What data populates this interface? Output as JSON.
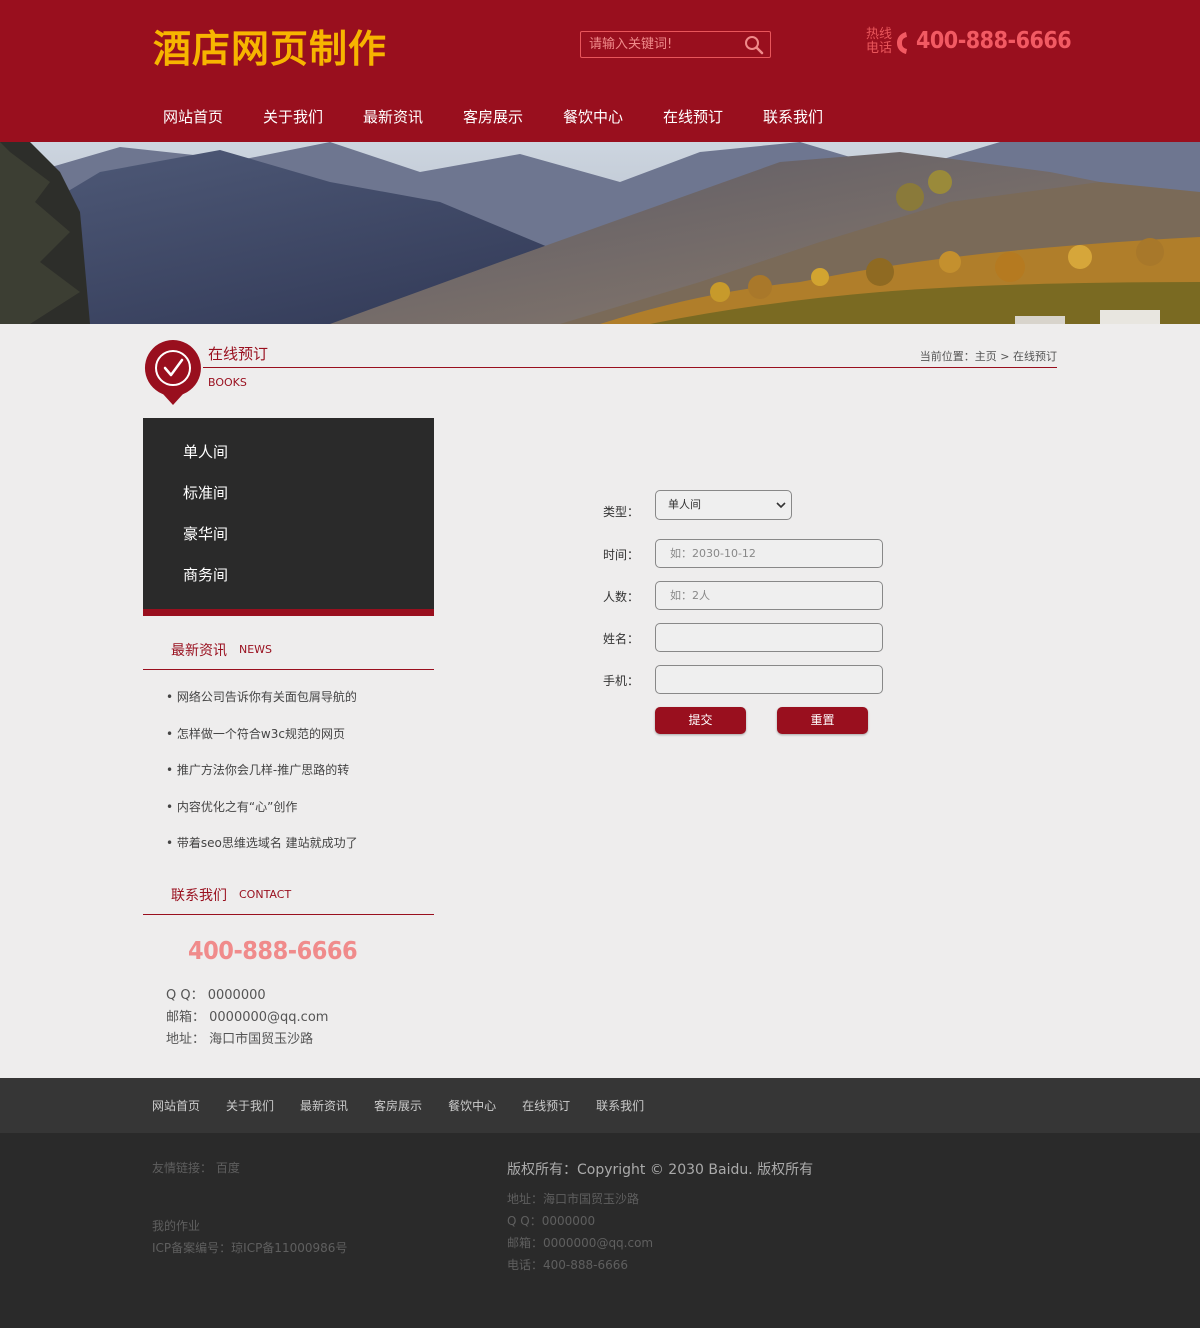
{
  "header": {
    "logo": "酒店网页制作",
    "search_placeholder": "请输入关键词!",
    "hotline_label_1": "热线",
    "hotline_label_2": "电话",
    "hotline_number": "400-888-6666"
  },
  "nav": [
    "网站首页",
    "关于我们",
    "最新资讯",
    "客房展示",
    "餐饮中心",
    "在线预订",
    "联系我们"
  ],
  "section": {
    "title": "在线预订",
    "subtitle": "BOOKS",
    "breadcrumb": "当前位置：主页 > 在线预订"
  },
  "sidebar": {
    "rooms": [
      "单人间",
      "标准间",
      "豪华间",
      "商务间"
    ],
    "news_title": "最新资讯",
    "news_en": "NEWS",
    "news": [
      "• 网络公司告诉你有关面包屑导航的",
      "• 怎样做一个符合w3c规范的网页",
      "• 推广方法你会几样-推广思路的转",
      "• 内容优化之有“心”创作",
      "• 带着seo思维选域名 建站就成功了"
    ],
    "contact_title": "联系我们",
    "contact_en": "CONTACT",
    "contact_phone": "400-888-6666",
    "contact_qq": "Q Q：  0000000",
    "contact_email": "邮箱：  0000000@qq.com",
    "contact_address": "地址：  海口市国贸玉沙路"
  },
  "form": {
    "type_label": "类型：",
    "type_value": "单人间",
    "time_label": "时间：",
    "time_placeholder": "如：2030-10-12",
    "people_label": "人数：",
    "people_placeholder": "如：2人",
    "name_label": "姓名：",
    "phone_label": "手机：",
    "submit": "提交",
    "reset": "重置"
  },
  "footer": {
    "nav": [
      "网站首页",
      "关于我们",
      "最新资讯",
      "客房展示",
      "餐饮中心",
      "在线预订",
      "联系我们"
    ],
    "links": "友情链接：   百度",
    "homework": "我的作业",
    "icp": "ICP备案编号：琼ICP备11000986号",
    "copyright": "版权所有：Copyright © 2030 Baidu. 版权所有",
    "address": "地址：海口市国贸玉沙路",
    "qq": "Q Q：0000000",
    "email": "邮箱：0000000@qq.com",
    "phone": "电话：400-888-6666"
  },
  "colors": {
    "brand": "#990f1e",
    "logo": "#f7b500",
    "phone": "#f25a63",
    "dark": "#2a2a2a"
  }
}
